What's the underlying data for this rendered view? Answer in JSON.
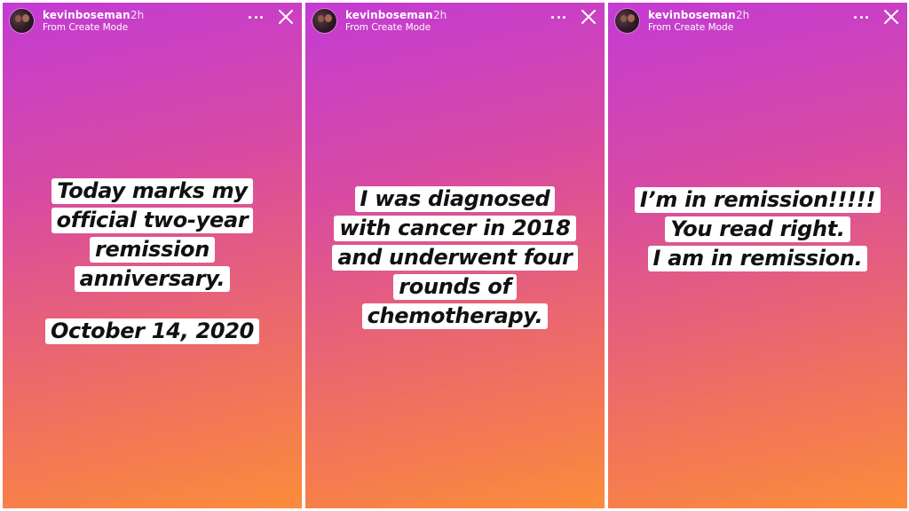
{
  "stories": [
    {
      "username": "kevinboseman",
      "time": "2h",
      "subtitle": "From Create Mode",
      "caption_lines": [
        "Today marks my",
        "official two-year",
        "remission",
        "anniversary."
      ],
      "date_line": "October 14, 2020"
    },
    {
      "username": "kevinboseman",
      "time": "2h",
      "subtitle": "From Create Mode",
      "caption_lines": [
        "I was diagnosed",
        "with cancer in 2018",
        "and underwent four",
        "rounds of",
        "chemotherapy."
      ]
    },
    {
      "username": "kevinboseman",
      "time": "2h",
      "subtitle": "From Create Mode",
      "caption_lines": [
        "I’m in remission!!!!!",
        "You read right.",
        "I am in remission."
      ]
    }
  ],
  "icons": {
    "more": "more-options-icon",
    "close": "close-icon",
    "avatar": "profile-avatar"
  },
  "colors": {
    "gradient_top": "#c33bd4",
    "gradient_bottom": "#fb8c3a",
    "caption_bg": "#ffffff",
    "caption_text": "#111111"
  }
}
